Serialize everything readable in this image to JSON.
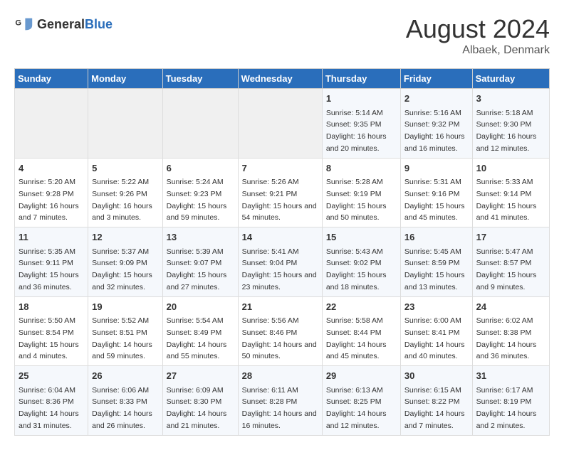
{
  "header": {
    "logo_general": "General",
    "logo_blue": "Blue",
    "title": "August 2024",
    "subtitle": "Albaek, Denmark"
  },
  "calendar": {
    "days_of_week": [
      "Sunday",
      "Monday",
      "Tuesday",
      "Wednesday",
      "Thursday",
      "Friday",
      "Saturday"
    ],
    "weeks": [
      [
        {
          "day": "",
          "empty": true
        },
        {
          "day": "",
          "empty": true
        },
        {
          "day": "",
          "empty": true
        },
        {
          "day": "",
          "empty": true
        },
        {
          "day": "1",
          "sunrise": "Sunrise: 5:14 AM",
          "sunset": "Sunset: 9:35 PM",
          "daylight": "Daylight: 16 hours and 20 minutes."
        },
        {
          "day": "2",
          "sunrise": "Sunrise: 5:16 AM",
          "sunset": "Sunset: 9:32 PM",
          "daylight": "Daylight: 16 hours and 16 minutes."
        },
        {
          "day": "3",
          "sunrise": "Sunrise: 5:18 AM",
          "sunset": "Sunset: 9:30 PM",
          "daylight": "Daylight: 16 hours and 12 minutes."
        }
      ],
      [
        {
          "day": "4",
          "sunrise": "Sunrise: 5:20 AM",
          "sunset": "Sunset: 9:28 PM",
          "daylight": "Daylight: 16 hours and 7 minutes."
        },
        {
          "day": "5",
          "sunrise": "Sunrise: 5:22 AM",
          "sunset": "Sunset: 9:26 PM",
          "daylight": "Daylight: 16 hours and 3 minutes."
        },
        {
          "day": "6",
          "sunrise": "Sunrise: 5:24 AM",
          "sunset": "Sunset: 9:23 PM",
          "daylight": "Daylight: 15 hours and 59 minutes."
        },
        {
          "day": "7",
          "sunrise": "Sunrise: 5:26 AM",
          "sunset": "Sunset: 9:21 PM",
          "daylight": "Daylight: 15 hours and 54 minutes."
        },
        {
          "day": "8",
          "sunrise": "Sunrise: 5:28 AM",
          "sunset": "Sunset: 9:19 PM",
          "daylight": "Daylight: 15 hours and 50 minutes."
        },
        {
          "day": "9",
          "sunrise": "Sunrise: 5:31 AM",
          "sunset": "Sunset: 9:16 PM",
          "daylight": "Daylight: 15 hours and 45 minutes."
        },
        {
          "day": "10",
          "sunrise": "Sunrise: 5:33 AM",
          "sunset": "Sunset: 9:14 PM",
          "daylight": "Daylight: 15 hours and 41 minutes."
        }
      ],
      [
        {
          "day": "11",
          "sunrise": "Sunrise: 5:35 AM",
          "sunset": "Sunset: 9:11 PM",
          "daylight": "Daylight: 15 hours and 36 minutes."
        },
        {
          "day": "12",
          "sunrise": "Sunrise: 5:37 AM",
          "sunset": "Sunset: 9:09 PM",
          "daylight": "Daylight: 15 hours and 32 minutes."
        },
        {
          "day": "13",
          "sunrise": "Sunrise: 5:39 AM",
          "sunset": "Sunset: 9:07 PM",
          "daylight": "Daylight: 15 hours and 27 minutes."
        },
        {
          "day": "14",
          "sunrise": "Sunrise: 5:41 AM",
          "sunset": "Sunset: 9:04 PM",
          "daylight": "Daylight: 15 hours and 23 minutes."
        },
        {
          "day": "15",
          "sunrise": "Sunrise: 5:43 AM",
          "sunset": "Sunset: 9:02 PM",
          "daylight": "Daylight: 15 hours and 18 minutes."
        },
        {
          "day": "16",
          "sunrise": "Sunrise: 5:45 AM",
          "sunset": "Sunset: 8:59 PM",
          "daylight": "Daylight: 15 hours and 13 minutes."
        },
        {
          "day": "17",
          "sunrise": "Sunrise: 5:47 AM",
          "sunset": "Sunset: 8:57 PM",
          "daylight": "Daylight: 15 hours and 9 minutes."
        }
      ],
      [
        {
          "day": "18",
          "sunrise": "Sunrise: 5:50 AM",
          "sunset": "Sunset: 8:54 PM",
          "daylight": "Daylight: 15 hours and 4 minutes."
        },
        {
          "day": "19",
          "sunrise": "Sunrise: 5:52 AM",
          "sunset": "Sunset: 8:51 PM",
          "daylight": "Daylight: 14 hours and 59 minutes."
        },
        {
          "day": "20",
          "sunrise": "Sunrise: 5:54 AM",
          "sunset": "Sunset: 8:49 PM",
          "daylight": "Daylight: 14 hours and 55 minutes."
        },
        {
          "day": "21",
          "sunrise": "Sunrise: 5:56 AM",
          "sunset": "Sunset: 8:46 PM",
          "daylight": "Daylight: 14 hours and 50 minutes."
        },
        {
          "day": "22",
          "sunrise": "Sunrise: 5:58 AM",
          "sunset": "Sunset: 8:44 PM",
          "daylight": "Daylight: 14 hours and 45 minutes."
        },
        {
          "day": "23",
          "sunrise": "Sunrise: 6:00 AM",
          "sunset": "Sunset: 8:41 PM",
          "daylight": "Daylight: 14 hours and 40 minutes."
        },
        {
          "day": "24",
          "sunrise": "Sunrise: 6:02 AM",
          "sunset": "Sunset: 8:38 PM",
          "daylight": "Daylight: 14 hours and 36 minutes."
        }
      ],
      [
        {
          "day": "25",
          "sunrise": "Sunrise: 6:04 AM",
          "sunset": "Sunset: 8:36 PM",
          "daylight": "Daylight: 14 hours and 31 minutes."
        },
        {
          "day": "26",
          "sunrise": "Sunrise: 6:06 AM",
          "sunset": "Sunset: 8:33 PM",
          "daylight": "Daylight: 14 hours and 26 minutes."
        },
        {
          "day": "27",
          "sunrise": "Sunrise: 6:09 AM",
          "sunset": "Sunset: 8:30 PM",
          "daylight": "Daylight: 14 hours and 21 minutes."
        },
        {
          "day": "28",
          "sunrise": "Sunrise: 6:11 AM",
          "sunset": "Sunset: 8:28 PM",
          "daylight": "Daylight: 14 hours and 16 minutes."
        },
        {
          "day": "29",
          "sunrise": "Sunrise: 6:13 AM",
          "sunset": "Sunset: 8:25 PM",
          "daylight": "Daylight: 14 hours and 12 minutes."
        },
        {
          "day": "30",
          "sunrise": "Sunrise: 6:15 AM",
          "sunset": "Sunset: 8:22 PM",
          "daylight": "Daylight: 14 hours and 7 minutes."
        },
        {
          "day": "31",
          "sunrise": "Sunrise: 6:17 AM",
          "sunset": "Sunset: 8:19 PM",
          "daylight": "Daylight: 14 hours and 2 minutes."
        }
      ]
    ]
  }
}
